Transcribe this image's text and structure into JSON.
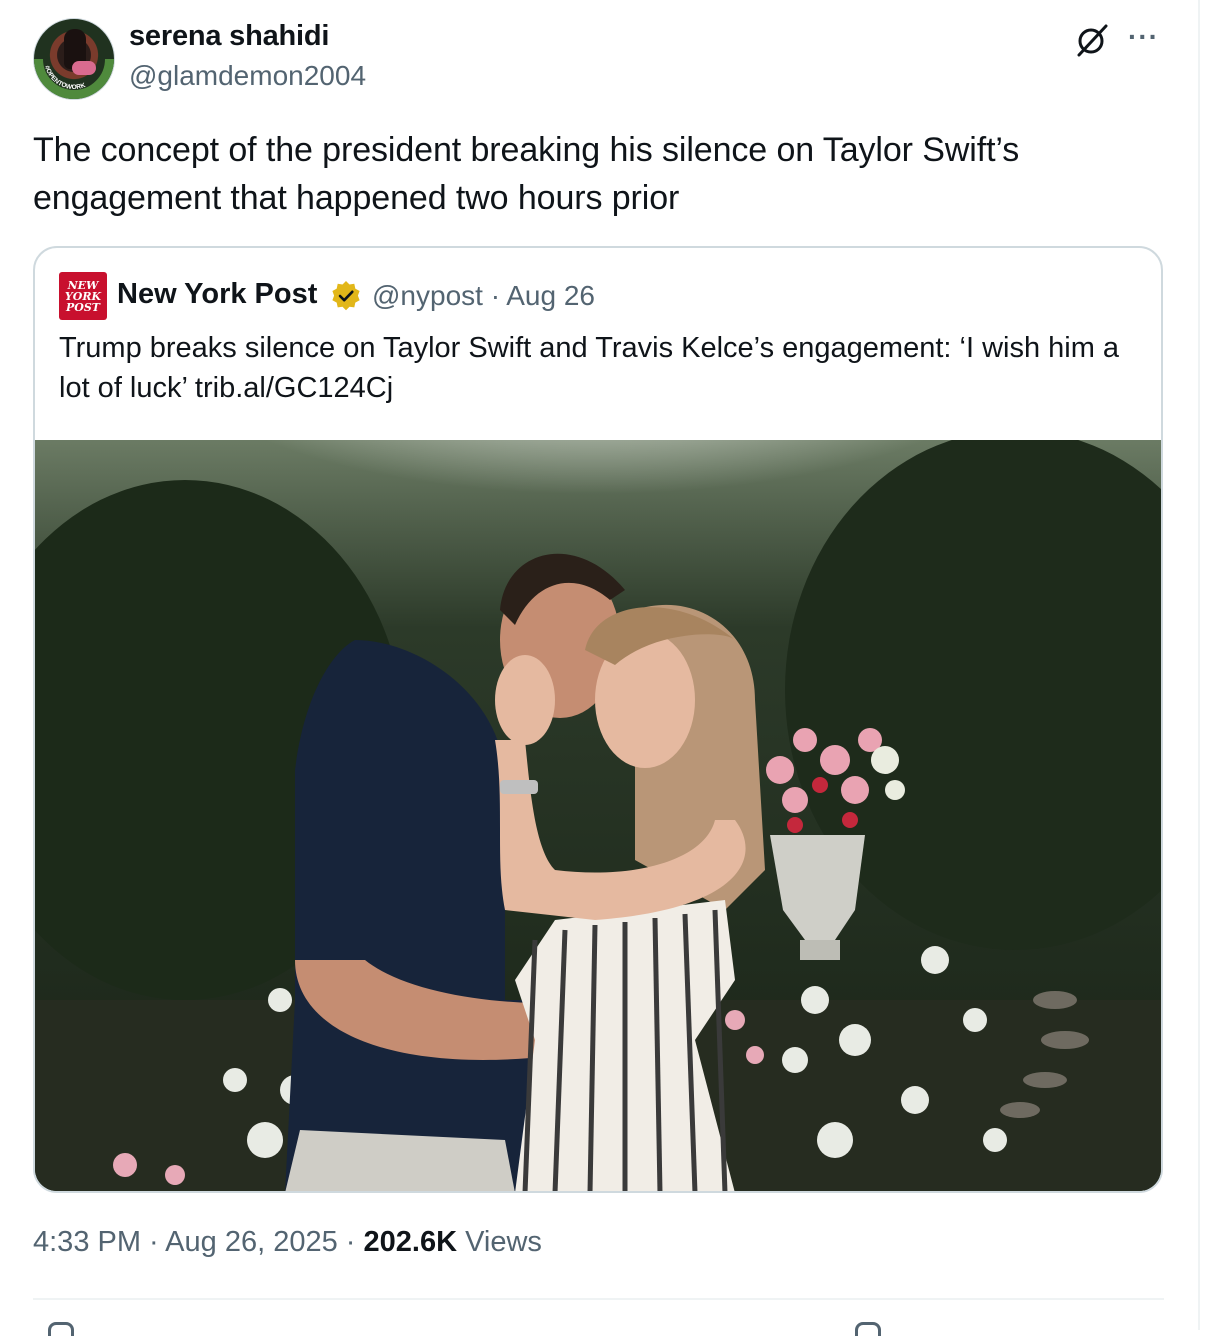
{
  "author": {
    "display_name": "serena shahidi",
    "handle": "@glamdemon2004",
    "avatar_ring_text": "#OPENTOWORK"
  },
  "tweet_text": "The concept of the president breaking his silence on Taylor Swift’s engagement that happened two hours prior",
  "quoted": {
    "logo_text": "NEW YORK POST",
    "name": "New York Post",
    "meta": "@nypost · Aug 26",
    "text": "Trump breaks silence on Taylor Swift and Travis Kelce’s engagement: ‘I wish him a lot of luck’ trib.al/GC124Cj"
  },
  "footer": {
    "time": "4:33 PM",
    "sep1": " · ",
    "date": "Aug 26, 2025",
    "sep2": " · ",
    "views_count": "202.6K",
    "views_label": " Views"
  },
  "icons": {
    "grok": "grok-icon",
    "more": "more-icon",
    "verified": "verified-badge-icon"
  },
  "colors": {
    "text_primary": "#0f1419",
    "text_secondary": "#536471",
    "border": "#cfd9de",
    "verified_gold": "#e2b719",
    "nyp_red": "#c8102e"
  }
}
